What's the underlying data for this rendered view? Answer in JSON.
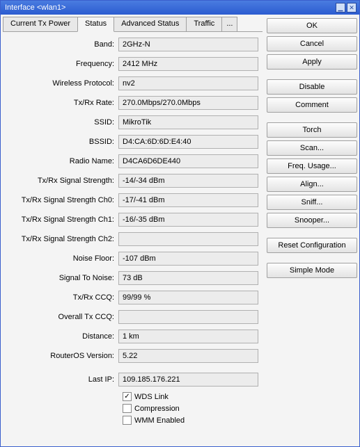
{
  "titlebar": {
    "text": "Interface <wlan1>"
  },
  "tabs": {
    "t0": "Current Tx Power",
    "t1": "Status",
    "t2": "Advanced Status",
    "t3": "Traffic",
    "t4": "..."
  },
  "fields": {
    "band": {
      "label": "Band:",
      "value": "2GHz-N"
    },
    "frequency": {
      "label": "Frequency:",
      "value": "2412 MHz"
    },
    "wireless_protocol": {
      "label": "Wireless Protocol:",
      "value": "nv2"
    },
    "txrx_rate": {
      "label": "Tx/Rx Rate:",
      "value": "270.0Mbps/270.0Mbps"
    },
    "ssid": {
      "label": "SSID:",
      "value": "MikroTik"
    },
    "bssid": {
      "label": "BSSID:",
      "value": "D4:CA:6D:6D:E4:40"
    },
    "radio_name": {
      "label": "Radio Name:",
      "value": "D4CA6D6DE440"
    },
    "signal_strength": {
      "label": "Tx/Rx Signal Strength:",
      "value": "-14/-34 dBm"
    },
    "signal_ch0": {
      "label": "Tx/Rx Signal Strength Ch0:",
      "value": "-17/-41 dBm"
    },
    "signal_ch1": {
      "label": "Tx/Rx Signal Strength Ch1:",
      "value": "-16/-35 dBm"
    },
    "signal_ch2": {
      "label": "Tx/Rx Signal Strength Ch2:",
      "value": ""
    },
    "noise_floor": {
      "label": "Noise Floor:",
      "value": "-107 dBm"
    },
    "signal_to_noise": {
      "label": "Signal To Noise:",
      "value": "73 dB"
    },
    "txrx_ccq": {
      "label": "Tx/Rx CCQ:",
      "value": "99/99 %"
    },
    "overall_tx_ccq": {
      "label": "Overall Tx CCQ:",
      "value": ""
    },
    "distance": {
      "label": "Distance:",
      "value": "1 km"
    },
    "routeros_version": {
      "label": "RouterOS Version:",
      "value": "5.22"
    },
    "last_ip": {
      "label": "Last IP:",
      "value": "109.185.176.221"
    }
  },
  "checks": {
    "wds_link": {
      "label": "WDS Link",
      "checked": true
    },
    "compression": {
      "label": "Compression",
      "checked": false
    },
    "wmm_enabled": {
      "label": "WMM Enabled",
      "checked": false
    }
  },
  "buttons": {
    "ok": "OK",
    "cancel": "Cancel",
    "apply": "Apply",
    "disable": "Disable",
    "comment": "Comment",
    "torch": "Torch",
    "scan": "Scan...",
    "freq_usage": "Freq. Usage...",
    "align": "Align...",
    "sniff": "Sniff...",
    "snooper": "Snooper...",
    "reset_config": "Reset Configuration",
    "simple_mode": "Simple Mode"
  }
}
